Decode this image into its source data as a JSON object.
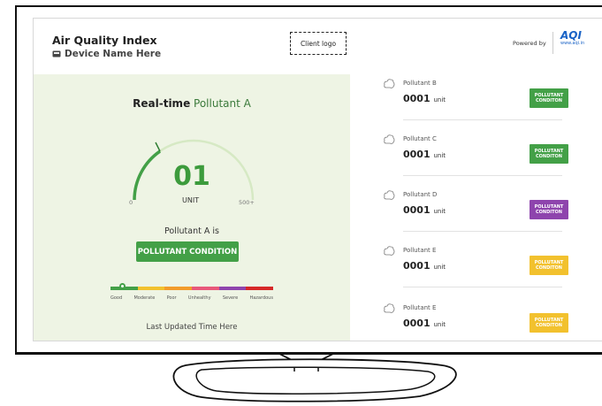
{
  "header": {
    "title": "Air Quality Index",
    "device_name": "Device Name Here",
    "client_logo": "Client logo",
    "powered_by": "Powered by",
    "aqi_logo_text": "AQI",
    "aqi_logo_url": "www.aqi.in"
  },
  "realtime": {
    "title_bold": "Real-time",
    "title_pollutant": "Pollutant A",
    "value": "01",
    "unit": "UNIT",
    "min_label": "0",
    "max_label": "500+",
    "gauge_fraction": 0.02,
    "status_prefix": "Pollutant A is",
    "condition_label": "POLLUTANT CONDITION",
    "condition_color": "#43a047",
    "scale": [
      {
        "label": "Good",
        "color": "#43a047"
      },
      {
        "label": "Moderate",
        "color": "#f2c12e"
      },
      {
        "label": "Poor",
        "color": "#f29c2b"
      },
      {
        "label": "Unhealthy",
        "color": "#e8587a"
      },
      {
        "label": "Severe",
        "color": "#8e44ad"
      },
      {
        "label": "Hazardous",
        "color": "#d62828"
      }
    ],
    "last_updated": "Last Updated Time Here"
  },
  "pollutants": [
    {
      "name": "Pollutant B",
      "value": "0001",
      "unit": "unit",
      "condition": "POLLUTANT CONDITON",
      "color": "#43a047"
    },
    {
      "name": "Pollutant C",
      "value": "0001",
      "unit": "unit",
      "condition": "POLLUTANT CONDITON",
      "color": "#43a047"
    },
    {
      "name": "Pollutant D",
      "value": "0001",
      "unit": "unit",
      "condition": "POLLUTANT CONDITON",
      "color": "#8e44ad"
    },
    {
      "name": "Pollutant E",
      "value": "0001",
      "unit": "unit",
      "condition": "POLLUTANT CONDITON",
      "color": "#f2c12e"
    },
    {
      "name": "Pollutant E",
      "value": "0001",
      "unit": "unit",
      "condition": "POLLUTANT CONDITON",
      "color": "#f2c12e"
    }
  ],
  "icons": {
    "device": "device-icon",
    "pollutant": "cloud-icon"
  }
}
